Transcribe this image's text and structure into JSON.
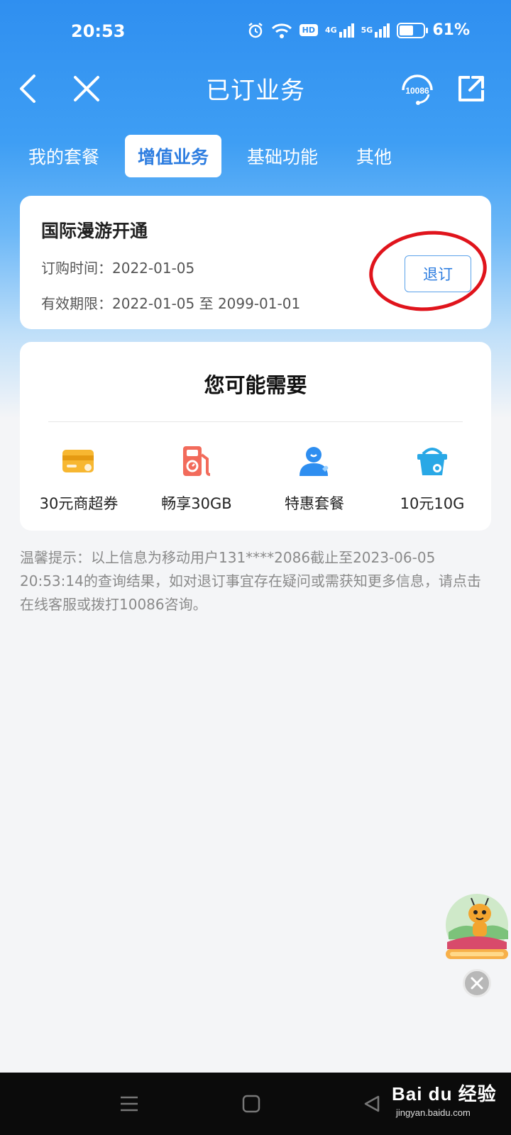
{
  "status_bar": {
    "time": "20:53",
    "hd_label": "HD",
    "net1": "4G",
    "net2": "5G",
    "battery": "61%",
    "battery_level": 0.61
  },
  "header": {
    "title": "已订业务",
    "service_number": "10086"
  },
  "tabs": [
    {
      "label": "我的套餐",
      "active": false
    },
    {
      "label": "增值业务",
      "active": true
    },
    {
      "label": "基础功能",
      "active": false
    },
    {
      "label": "其他",
      "active": false
    }
  ],
  "subscription": {
    "name": "国际漫游开通",
    "order_time_label": "订购时间：",
    "order_time": "2022-01-05",
    "valid_label": "有效期限：",
    "valid_range": "2022-01-05 至 2099-01-01",
    "unsubscribe_label": "退订"
  },
  "recommend": {
    "title": "您可能需要",
    "items": [
      {
        "label": "30元商超券",
        "icon": "coupon-card-icon"
      },
      {
        "label": "畅享30GB",
        "icon": "fuel-pump-icon"
      },
      {
        "label": "特惠套餐",
        "icon": "user-heart-icon"
      },
      {
        "label": "10元10G",
        "icon": "basket-icon"
      }
    ]
  },
  "notice": "温馨提示：以上信息为移动用户131****2086截止至2023-06-05 20:53:14的查询结果，如对退订事宜存在疑问或需获知更多信息，请点击在线客服或拨打10086咨询。",
  "watermark": {
    "main": "Bai du 经验",
    "sub": "jingyan.baidu.com"
  },
  "colors": {
    "accent": "#2d7de0",
    "header_blue": "#2f8ff0",
    "annotation_red": "#e0141c"
  }
}
